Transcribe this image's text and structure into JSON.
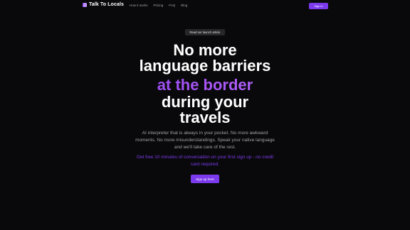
{
  "nav": {
    "brand": "Talk To Locals",
    "links": [
      "How it works",
      "Pricing",
      "FAQ",
      "Blog"
    ],
    "signin": "Sign in"
  },
  "hero": {
    "pill": "Read our launch article",
    "line1": "No more",
    "line2": "language barriers",
    "line3": "at the border",
    "line4": "during your",
    "line5": "travels",
    "description": "AI interpreter that is always in your pocket. No more awkward moments. No more misunderstandings. Speak your native language and we'll take care of the rest.",
    "promo": "Get free 10 minutes of conversation on your first sign up - no credit card required.",
    "cta": "Sign up here"
  },
  "colors": {
    "accent": "#7c3aed",
    "background": "#09090b"
  }
}
